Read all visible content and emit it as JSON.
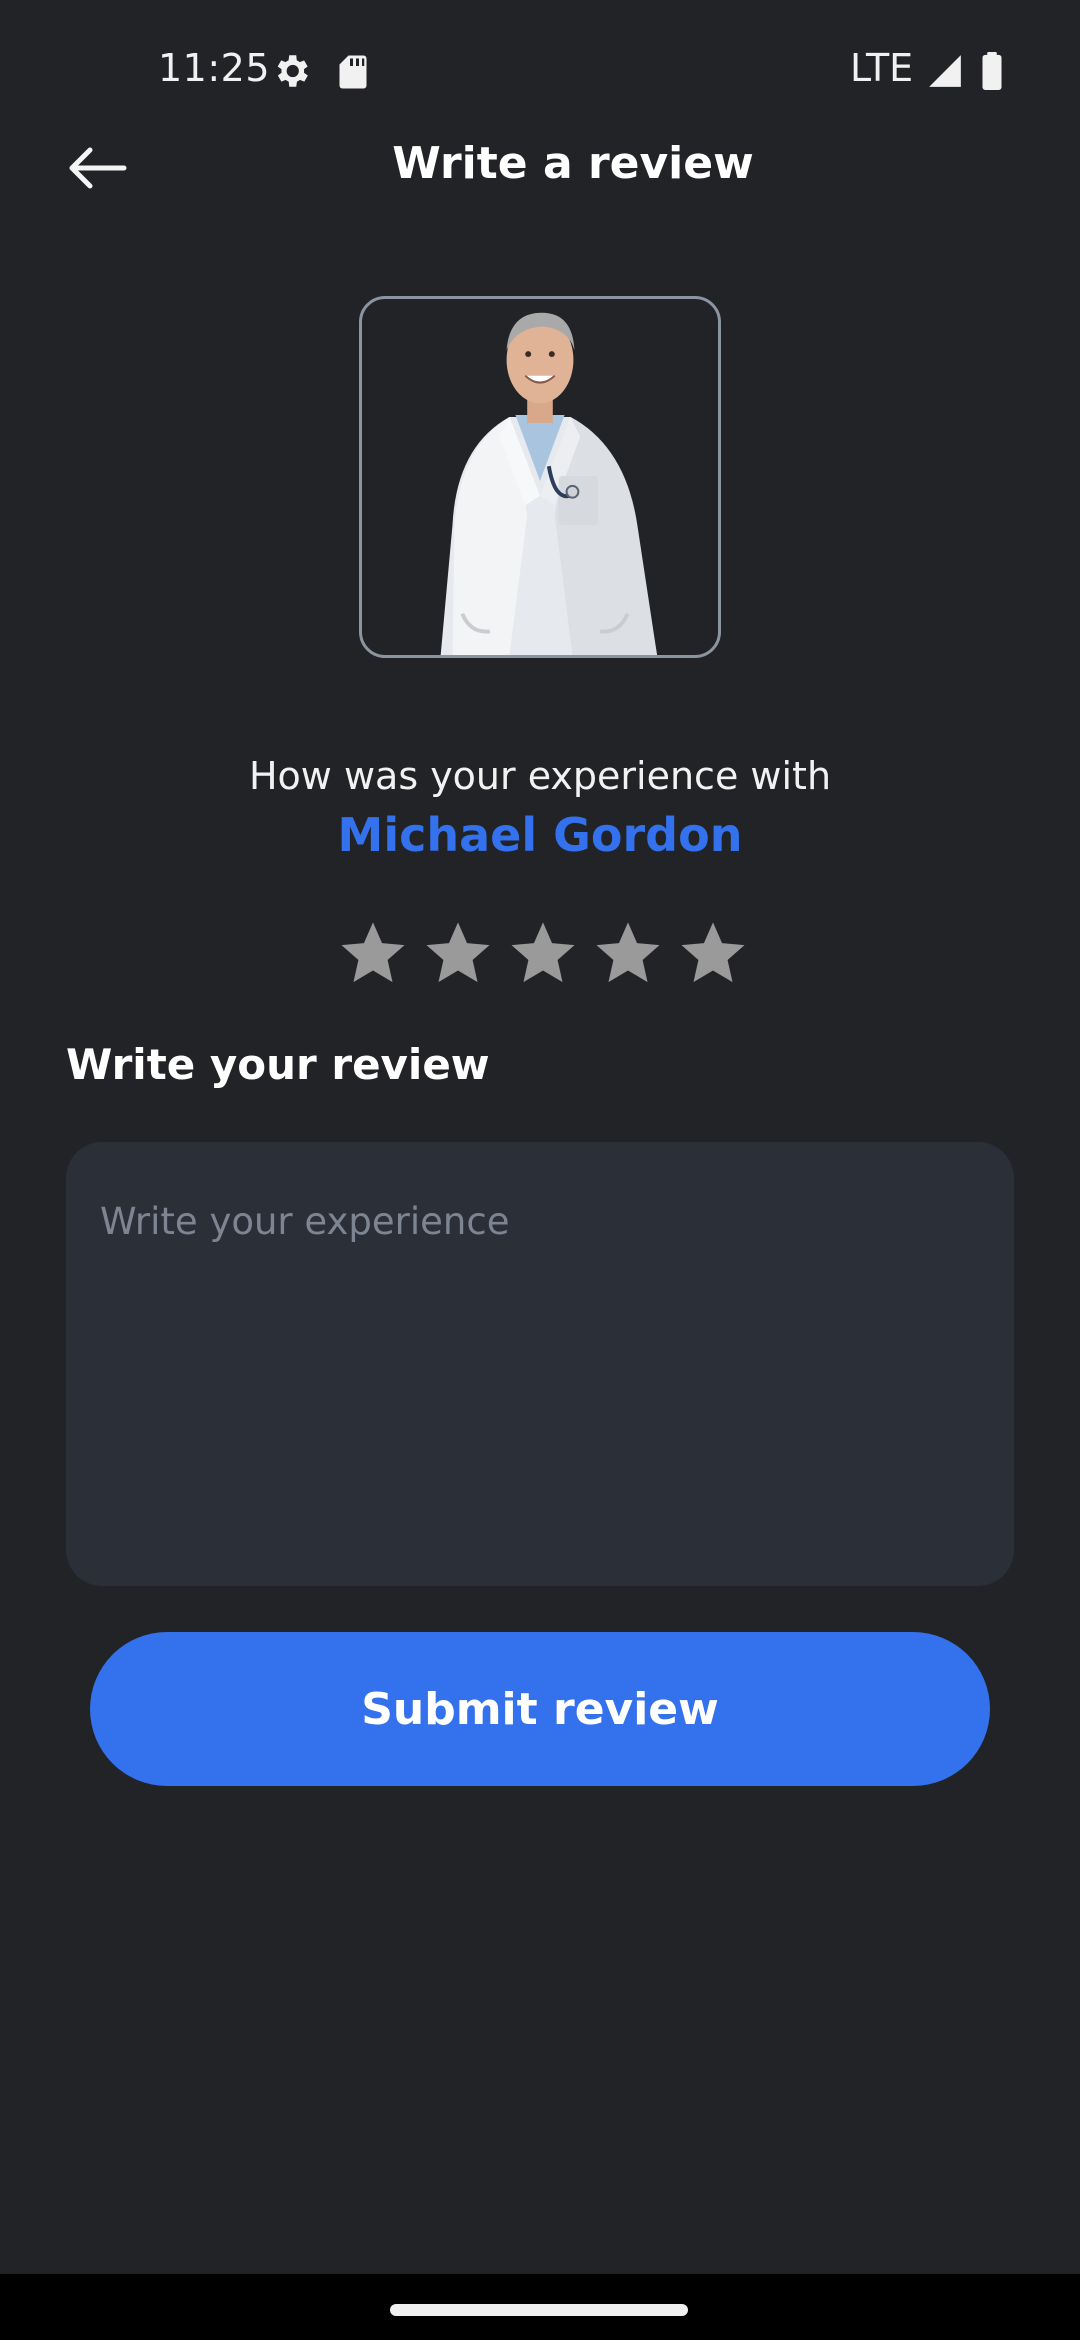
{
  "status_bar": {
    "time": "11:25",
    "network": "LTE",
    "icons": [
      "settings-gear-icon",
      "sd-card-icon",
      "signal-icon",
      "battery-icon"
    ]
  },
  "header": {
    "title": "Write a review",
    "back_icon": "arrow-left-icon"
  },
  "doctor": {
    "question": "How was your experience with",
    "name": "Michael Gordon"
  },
  "rating": {
    "max": 5,
    "selected": 0
  },
  "review": {
    "heading": "Write your review",
    "placeholder": "Write your experience",
    "value": ""
  },
  "submit": {
    "label": "Submit review"
  },
  "colors": {
    "background": "#222327",
    "accent": "#3471ec",
    "input_background": "#2a2f38",
    "star_inactive": "#9a9a9a",
    "avatar_border": "#8b94a0"
  }
}
